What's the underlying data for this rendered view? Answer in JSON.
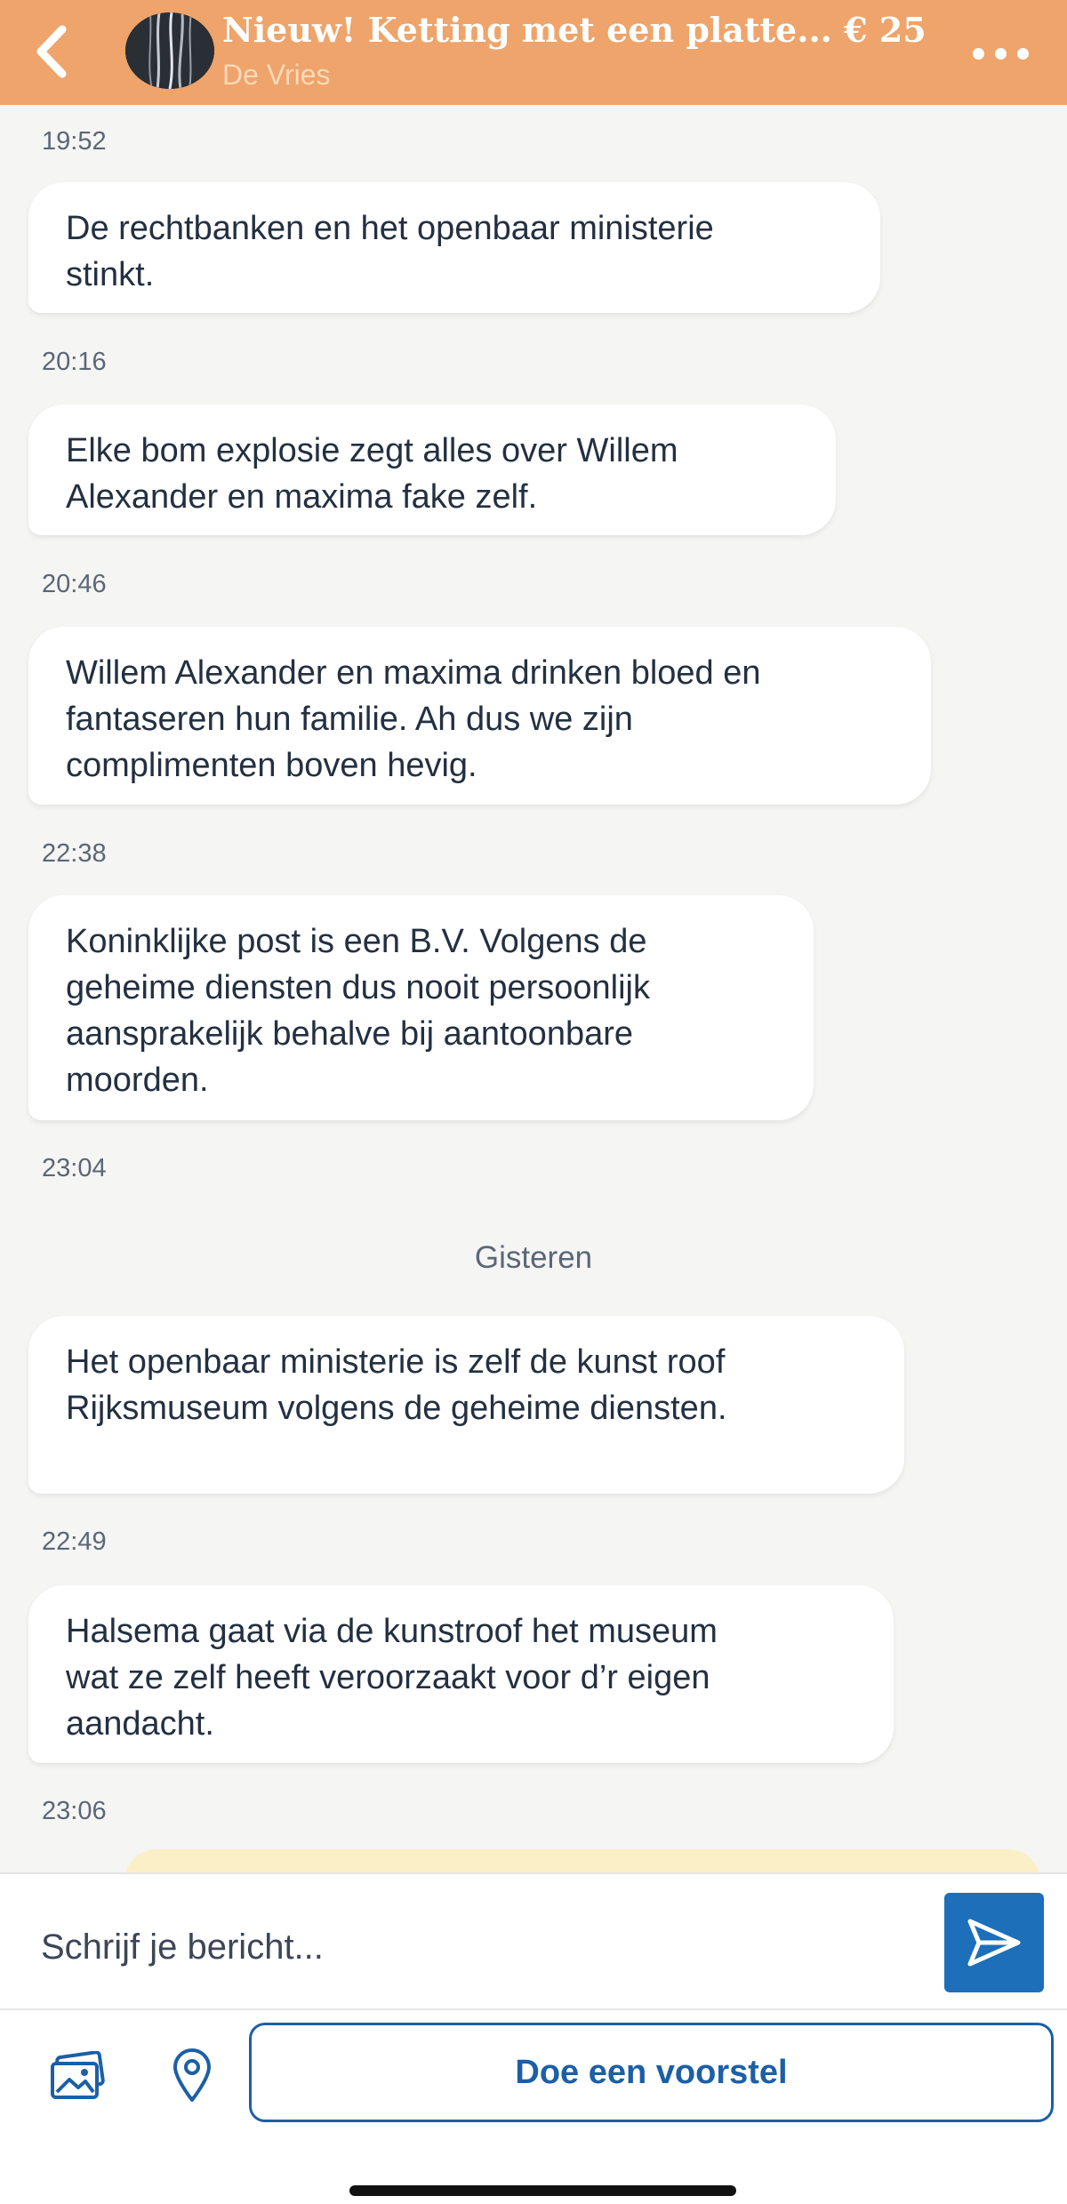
{
  "header": {
    "title": "Nieuw! Ketting met een platte... € 25,00",
    "seller": "De Vries",
    "back_icon": "chevron-left-icon",
    "menu_icon": "more-dots-icon"
  },
  "messages": [
    {
      "text": "De rechtbanken en het openbaar ministerie\nstinkt.",
      "time": "19:52"
    },
    {
      "text": "Elke bom explosie zegt alles over Willem\nAlexander en maxima fake zelf.",
      "time": "20:16"
    },
    {
      "text": "Willem Alexander en maxima drinken bloed en\nfantaseren hun familie. Ah dus we zijn\ncomplimenten boven hevig.",
      "time": "20:46"
    },
    {
      "text": "Koninklijke post is een B.V. Volgens de\ngeheime diensten dus nooit persoonlijk\naansprakelijk behalve bij aantoonbare\nmoorden.",
      "time": "22:38"
    },
    {
      "time": "23:04"
    },
    {
      "day_separator": "Gisteren"
    },
    {
      "text": "Het openbaar ministerie is zelf de kunst roof\nRijksmuseum volgens de geheime diensten.",
      "time": "22:49"
    },
    {
      "text": "Halsema gaat via de kunstroof het museum\nwat ze zelf heeft veroorzaakt voor d’r eigen\naandacht.",
      "time": "23:06"
    }
  ],
  "composer": {
    "placeholder": "Schrijf je bericht...",
    "send_icon": "send-icon",
    "photo_icon": "photo-gallery-icon",
    "location_icon": "location-pin-icon",
    "offer_label": "Doe een voorstel"
  },
  "colors": {
    "header_bg": "#eea46a",
    "accent_blue": "#1c6fb8",
    "chat_bg": "#f5f5f4",
    "bubble_bg": "#ffffff"
  }
}
